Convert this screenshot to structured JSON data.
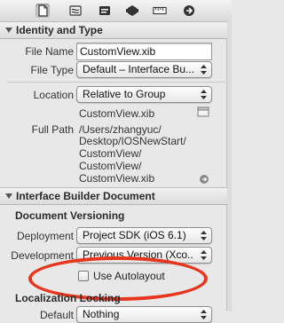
{
  "toolbar": {
    "icons": [
      "file-inspector-icon",
      "quick-help-icon",
      "identity-inspector-icon",
      "attributes-inspector-icon",
      "size-inspector-icon",
      "connections-inspector-icon"
    ]
  },
  "identity_type": {
    "header": "Identity and Type",
    "file_name_label": "File Name",
    "file_name_value": "CustomView.xib",
    "file_type_label": "File Type",
    "file_type_value": "Default – Interface Bu...",
    "location_label": "Location",
    "location_value": "Relative to Group",
    "relative_file": "CustomView.xib",
    "full_path_label": "Full Path",
    "full_path_lines": [
      "/Users/zhangyuc/",
      "Desktop/IOSNewStart/",
      "CustomView/",
      "CustomView/",
      "CustomView.xib"
    ]
  },
  "ib_document": {
    "header": "Interface Builder Document",
    "versioning_title": "Document Versioning",
    "deployment_label": "Deployment",
    "deployment_value": "Project SDK (iOS 6.1)",
    "development_label": "Development",
    "development_value": "Previous Version (Xco...",
    "autolayout_label": "Use Autolayout",
    "autolayout_checked": false,
    "localization_title": "Localization Locking",
    "default_label": "Default",
    "default_value": "Nothing"
  },
  "colors": {
    "highlight_ring": "#e8361e",
    "panel_bg": "#e8e8e8"
  }
}
